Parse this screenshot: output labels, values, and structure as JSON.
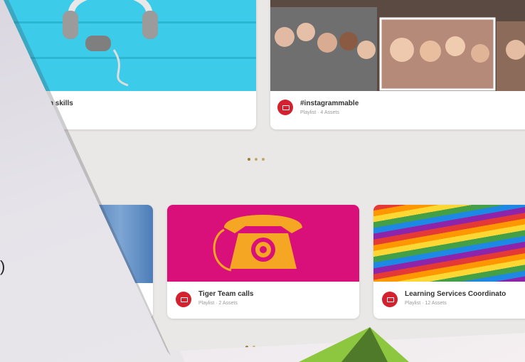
{
  "cards": [
    {
      "title": "ion skills",
      "subtitle": ""
    },
    {
      "title": "#instagrammable",
      "subtitle": "Playlist · 4 Assets"
    },
    {
      "title": "",
      "subtitle": ""
    },
    {
      "title": "Tiger Team calls",
      "subtitle": "Playlist · 2 Assets"
    },
    {
      "title": "Learning Services Coordinato",
      "subtitle": "Playlist · 12 Assets"
    }
  ],
  "side_glyph": ")",
  "colors": {
    "accent_red": "#d3212f",
    "tiger_pink": "#d90f7a",
    "phone_orange": "#f5a623",
    "headphones_cyan": "#2ec8e6",
    "green": "#8dc63f"
  },
  "carousel": {
    "pages": 3,
    "active": 1
  }
}
